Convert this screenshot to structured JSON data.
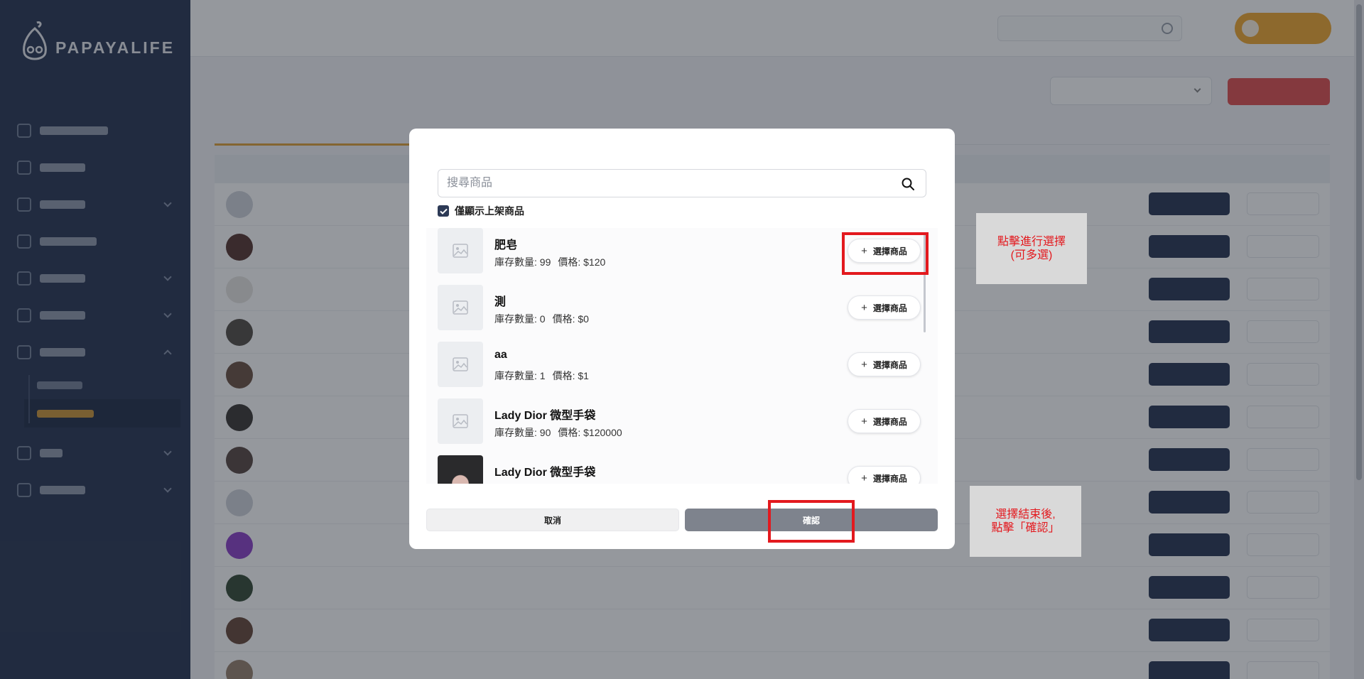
{
  "brand": {
    "name": "PAPAYALIFE",
    "sub": ""
  },
  "sidebar": {
    "items": [
      {
        "icon": "home-icon"
      },
      {
        "icon": "chart-icon"
      },
      {
        "icon": "settings-icon",
        "expandable": true
      },
      {
        "icon": "layout-icon"
      },
      {
        "icon": "box-icon",
        "expandable": true
      },
      {
        "icon": "cart-icon",
        "expandable": true
      },
      {
        "icon": "users-icon",
        "expandable": true
      }
    ],
    "sub_items": [
      {
        "active": false
      },
      {
        "active": true
      }
    ],
    "more": [
      {
        "icon": "gift-icon",
        "expandable": true
      },
      {
        "icon": "store-icon",
        "expandable": true
      }
    ]
  },
  "modal": {
    "search_placeholder": "搜尋商品",
    "onshelf_label": "僅顯示上架商品",
    "onshelf_checked": true,
    "products": [
      {
        "name": "肥皂",
        "stock_label": "庫存數量: 99",
        "price_label": "價格: $120",
        "has_photo": false,
        "button": "選擇商品"
      },
      {
        "name": "測",
        "stock_label": "庫存數量: 0",
        "price_label": "價格: $0",
        "has_photo": false,
        "button": "選擇商品"
      },
      {
        "name": "aa",
        "stock_label": "庫存數量: 1",
        "price_label": "價格: $1",
        "has_photo": false,
        "button": "選擇商品"
      },
      {
        "name": "Lady Dior 微型手袋",
        "stock_label": "庫存數量: 90",
        "price_label": "價格: $120000",
        "has_photo": false,
        "button": "選擇商品"
      },
      {
        "name": "Lady Dior 微型手袋",
        "stock_label": "",
        "price_label": "",
        "has_photo": true,
        "button": "選擇商品"
      }
    ],
    "cancel_label": "取消",
    "confirm_label": "確認"
  },
  "annotations": {
    "select_note_line1": "點擊進行選擇",
    "select_note_line2": "(可多選)",
    "confirm_note_line1": "選擇結束後,",
    "confirm_note_line2": "點擊「確認」"
  },
  "colors": {
    "sidebar": "#2d3a56",
    "accent": "#e0a23b",
    "highlight": "#e3191e",
    "confirm": "#7e838d"
  }
}
